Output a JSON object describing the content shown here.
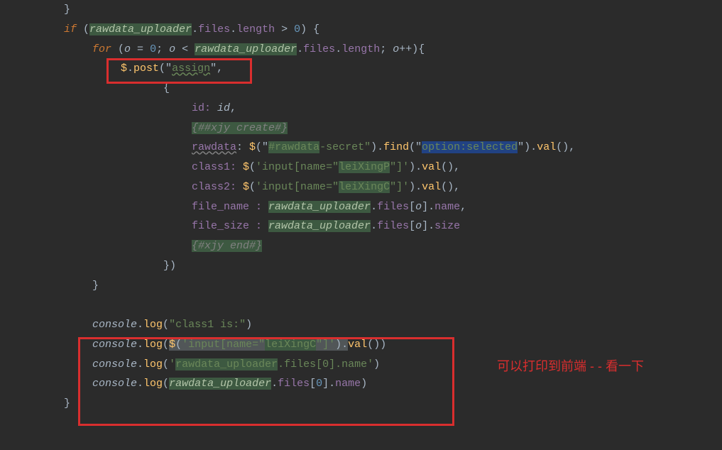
{
  "code": {
    "line1_p1": "}",
    "line2_kw": "if",
    "line2_p1": " (",
    "line2_v1": "rawdata_uploader",
    "line2_p2": ".",
    "line2_prop1": "files",
    "line2_p3": ".",
    "line2_prop2": "length",
    "line2_p4": " > ",
    "line2_num": "0",
    "line2_p5": ") {",
    "line3_kw": "for",
    "line3_p1": " (",
    "line3_o1": "o",
    "line3_p2": " = ",
    "line3_num1": "0",
    "line3_p3": "; ",
    "line3_o2": "o",
    "line3_p4": " < ",
    "line3_v1": "rawdata_uploader",
    "line3_p5": ".",
    "line3_prop1": "files",
    "line3_p6": ".",
    "line3_prop2": "length",
    "line3_p7": "; ",
    "line3_o3": "o",
    "line3_p8": "++){",
    "line4_d": "$",
    "line4_p1": ".",
    "line4_fn": "post",
    "line4_p2": "(\"",
    "line4_url": "assign",
    "line4_p3": "\",",
    "line5_p1": "{",
    "line6_p1": "id: ",
    "line6_v": "id",
    "line6_p2": ",",
    "line7_c": "{##xjy create#}",
    "line8_k": "rawdata",
    "line8_p1": ": ",
    "line8_d": "$",
    "line8_p2": "(\"",
    "line8_s1": "#rawdata",
    "line8_s2": "-secret\"",
    "line8_p3": ").",
    "line8_fn1": "find",
    "line8_p4": "(\"",
    "line8_s3": "option:selected",
    "line8_p5": "\").",
    "line8_fn2": "val",
    "line8_p6": "(),",
    "line9_k": "class1: ",
    "line9_d": "$",
    "line9_p1": "(",
    "line9_s1": "'input[name=\"",
    "line9_s2": "leiXingP",
    "line9_s3": "\"]'",
    "line9_p2": ").",
    "line9_fn": "val",
    "line9_p3": "(),",
    "line10_k": "class2: ",
    "line10_d": "$",
    "line10_p1": "(",
    "line10_s1": "'input[name=\"",
    "line10_s2": "leiXingC",
    "line10_s3": "\"]'",
    "line10_p2": ").",
    "line10_fn": "val",
    "line10_p3": "(),",
    "line11_k": "file_name : ",
    "line11_v": "rawdata_uploader",
    "line11_p1": ".",
    "line11_prop1": "files",
    "line11_p2": "[",
    "line11_o": "o",
    "line11_p3": "].",
    "line11_prop2": "name",
    "line11_p4": ",",
    "line12_k": "file_size : ",
    "line12_v": "rawdata_uploader",
    "line12_p1": ".",
    "line12_prop1": "files",
    "line12_p2": "[",
    "line12_o": "o",
    "line12_p3": "].",
    "line12_prop2": "size",
    "line13_c": "{#xjy end#}",
    "line14_p1": "})",
    "line15_p1": "}",
    "line16_blank": "",
    "line17_c": "console",
    "line17_p1": ".",
    "line17_fn": "log",
    "line17_p2": "(",
    "line17_s": "\"class1 is:\"",
    "line17_p3": ")",
    "line18_c": "console",
    "line18_p1": ".",
    "line18_fn": "log",
    "line18_p2": "(",
    "line18_d": "$",
    "line18_p3": "(",
    "line18_s1": "'input[name=\"",
    "line18_s2": "leiXingC",
    "line18_s3": "\"]'",
    "line18_p4": ").",
    "line18_fn2": "val",
    "line18_p5": "())",
    "line19_c": "console",
    "line19_p1": ".",
    "line19_fn": "log",
    "line19_p2": "(",
    "line19_s1": "'",
    "line19_s2": "rawdata_uploader",
    "line19_s3": ".files[",
    "line19_s4": "0",
    "line19_s5": "].name'",
    "line19_p3": ")",
    "line20_c": "console",
    "line20_p1": ".",
    "line20_fn": "log",
    "line20_p2": "(",
    "line20_v": "rawdata_uploader",
    "line20_p3": ".",
    "line20_prop1": "files",
    "line20_p4": "[",
    "line20_num": "0",
    "line20_p5": "].",
    "line20_prop2": "name",
    "line20_p6": ")",
    "line21_p1": "}"
  },
  "annotation_text": "可以打印到前端 - - 看一下"
}
